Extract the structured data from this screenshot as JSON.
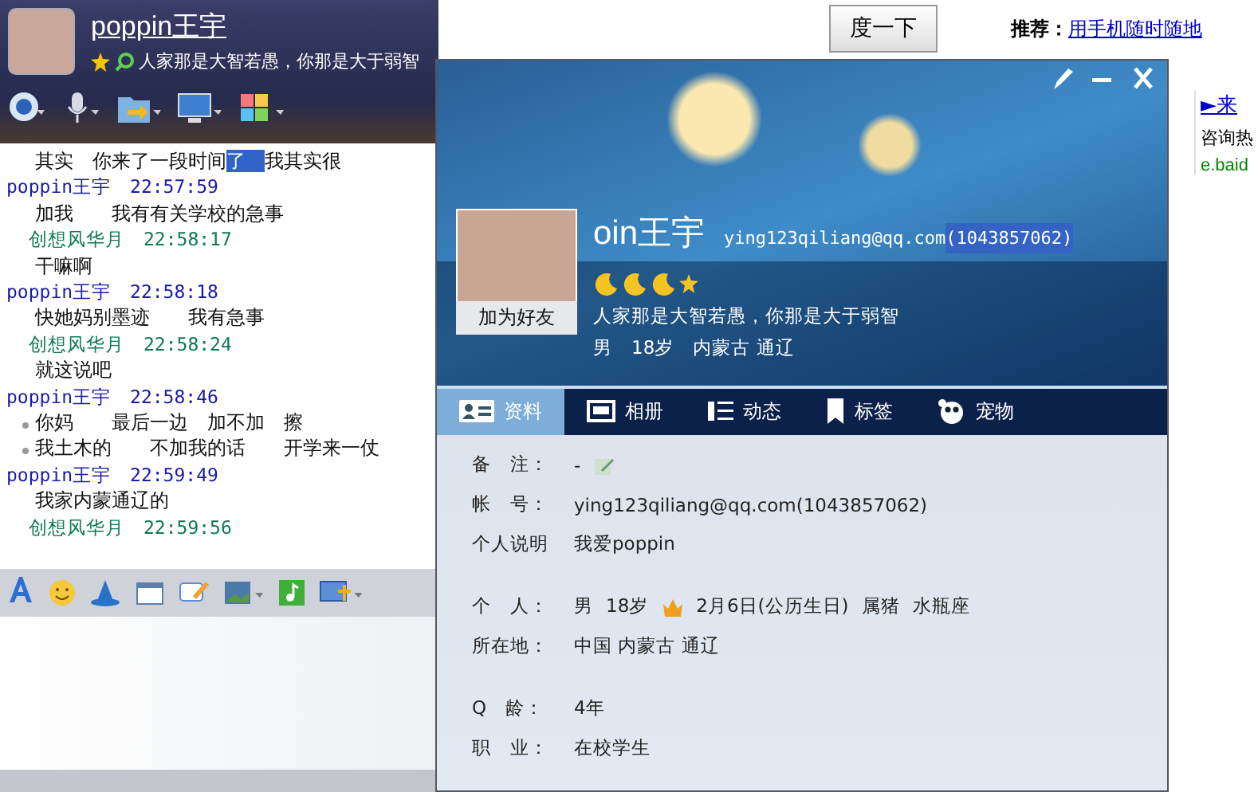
{
  "chat": {
    "contact_name": "poppin王宇",
    "signature": "人家那是大智若愚，你那是大于弱智",
    "messages": [
      {
        "kind": "text",
        "parts": [
          {
            "text": "其实　你来了一段时间",
            "selected": false
          },
          {
            "text": "了　",
            "selected": true
          },
          {
            "text": "我其实很",
            "selected": false
          }
        ]
      },
      {
        "kind": "header",
        "sender": "poppin王宇",
        "time": "22:57:59",
        "self": false
      },
      {
        "kind": "text",
        "parts": [
          {
            "text": "加我　　我有有关学校的急事",
            "selected": false
          }
        ]
      },
      {
        "kind": "header",
        "sender": "创想风华月",
        "time": "22:58:17",
        "self": true
      },
      {
        "kind": "text",
        "parts": [
          {
            "text": "干嘛啊",
            "selected": false
          }
        ]
      },
      {
        "kind": "header",
        "sender": "poppin王宇",
        "time": "22:58:18",
        "self": false
      },
      {
        "kind": "text",
        "parts": [
          {
            "text": "快她妈别墨迹　　我有急事",
            "selected": false
          }
        ]
      },
      {
        "kind": "header",
        "sender": "创想风华月",
        "time": "22:58:24",
        "self": true
      },
      {
        "kind": "text",
        "parts": [
          {
            "text": "就这说吧",
            "selected": false
          }
        ]
      },
      {
        "kind": "header",
        "sender": "poppin王宇",
        "time": "22:58:46",
        "self": false
      },
      {
        "kind": "bullet",
        "parts": [
          {
            "text": "你妈　　最后一边　加不加　擦",
            "selected": false
          }
        ]
      },
      {
        "kind": "bullet",
        "parts": [
          {
            "text": "我土木的　　不加我的话　　开学来一仗",
            "selected": false
          }
        ]
      },
      {
        "kind": "header",
        "sender": "poppin王宇",
        "time": "22:59:49",
        "self": false
      },
      {
        "kind": "text",
        "parts": [
          {
            "text": "我家内蒙通辽的",
            "selected": false
          }
        ]
      },
      {
        "kind": "header",
        "sender": "创想风华月",
        "time": "22:59:56",
        "self": true
      }
    ]
  },
  "web": {
    "search_button": "度一下",
    "recommend_label": "推荐：",
    "recommend_link": "用手机随时随地",
    "ad_link": "►来",
    "ad_text": "咨询热",
    "ad_url": "e.baid"
  },
  "profile": {
    "name": "oin王宇",
    "email": "ying123qiliang@qq.com",
    "qq_number": "(1043857062)",
    "number_selected": true,
    "signature": "人家那是大智若愚，你那是大于弱智",
    "summary": [
      "男",
      "18岁",
      "内蒙古 通辽"
    ],
    "add_friend_button": "加为好友",
    "tabs": [
      {
        "label": "资料",
        "kind": "profile",
        "selected": true
      },
      {
        "label": "相册",
        "kind": "album",
        "selected": false
      },
      {
        "label": "动态",
        "kind": "feed",
        "selected": false
      },
      {
        "label": "标签",
        "kind": "tag",
        "selected": false
      },
      {
        "label": "宠物",
        "kind": "pet",
        "selected": false
      }
    ],
    "sections": [
      [
        {
          "label": "备　注：",
          "values": [
            {
              "text": "-",
              "kind": "edit"
            }
          ]
        },
        {
          "label": "帐　号：",
          "values": [
            {
              "text": "ying123qiliang@qq.com(1043857062)"
            }
          ]
        },
        {
          "label": "个人说明",
          "values": [
            {
              "text": "我爱poppin"
            }
          ]
        }
      ],
      [
        {
          "label": "个　人：",
          "values": [
            {
              "text": "男"
            },
            {
              "text": "18岁"
            },
            {
              "text": "2月6日(公历生日)",
              "kind": "crown"
            },
            {
              "text": "属猪"
            },
            {
              "text": "水瓶座"
            }
          ]
        },
        {
          "label": "所在地：",
          "values": [
            {
              "text": "中国 内蒙古 通辽"
            }
          ]
        }
      ],
      [
        {
          "label": "Q　龄：",
          "values": [
            {
              "text": "4年"
            }
          ]
        },
        {
          "label": "职　业：",
          "values": [
            {
              "text": "在校学生"
            }
          ]
        }
      ]
    ]
  }
}
